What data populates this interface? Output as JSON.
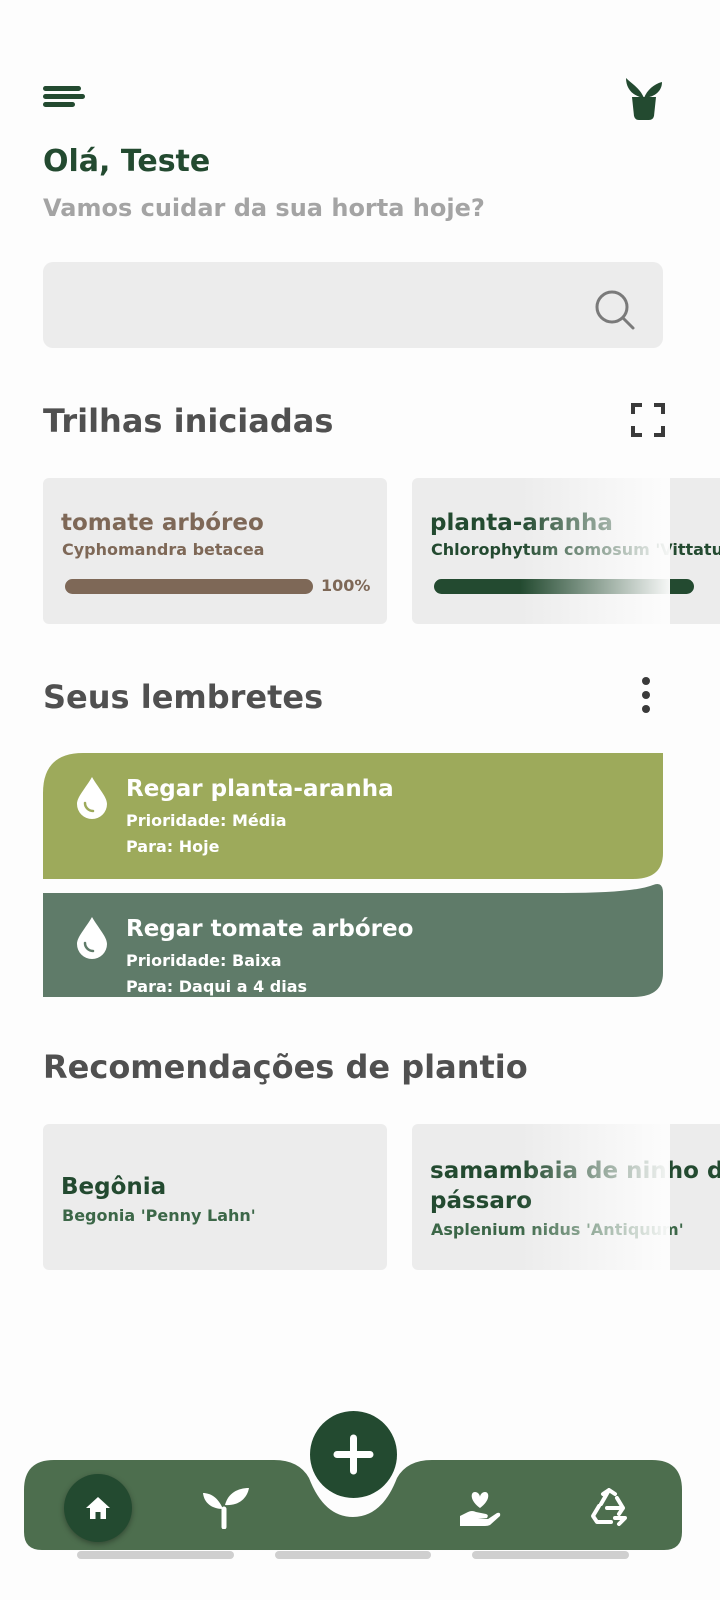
{
  "header": {
    "menu_icon": "menu-icon",
    "logo_icon": "plant-pot-logo-icon",
    "greeting": "Olá, Teste",
    "subtitle": "Vamos cuidar da sua horta hoje?"
  },
  "search": {
    "placeholder": "",
    "icon": "search-icon"
  },
  "trails": {
    "title": "Trilhas iniciadas",
    "expand_icon": "expand-icon",
    "items": [
      {
        "name": "tomate arbóreo",
        "scientific": "Cyphomandra betacea",
        "progress": 100,
        "progress_label": "100%",
        "color": "#7e6857"
      },
      {
        "name": "planta-aranha",
        "scientific": "Chlorophytum comosum 'Vittatum'",
        "color": "#234a30"
      }
    ]
  },
  "reminders": {
    "title": "Seus lembretes",
    "more_icon": "more-vertical-icon",
    "items": [
      {
        "title": "Regar planta-aranha",
        "priority": "Prioridade: Média",
        "due": "Para: Hoje",
        "color": "#9daa5b",
        "icon": "water-drop-icon"
      },
      {
        "title": "Regar tomate arbóreo",
        "priority": "Prioridade: Baixa",
        "due": "Para: Daqui a 4 dias",
        "color": "#5f7b69",
        "icon": "water-drop-icon"
      }
    ]
  },
  "recommendations": {
    "title": "Recomendações de plantio",
    "items": [
      {
        "name": "Begônia",
        "scientific": "Begonia 'Penny Lahn'"
      },
      {
        "name_line1": "samambaia de ninho de",
        "name_line2": "pássaro",
        "scientific": "Asplenium nidus 'Antiquum'"
      }
    ]
  },
  "bottom_nav": {
    "bar_color": "#4d6e4e",
    "accent_color": "#234a30",
    "items": [
      {
        "icon": "home-icon",
        "active": true
      },
      {
        "icon": "sprout-icon",
        "active": false
      },
      {
        "icon": "plus-icon",
        "active": false
      },
      {
        "icon": "hand-heart-icon",
        "active": false
      },
      {
        "icon": "recycle-icon",
        "active": false
      }
    ]
  }
}
